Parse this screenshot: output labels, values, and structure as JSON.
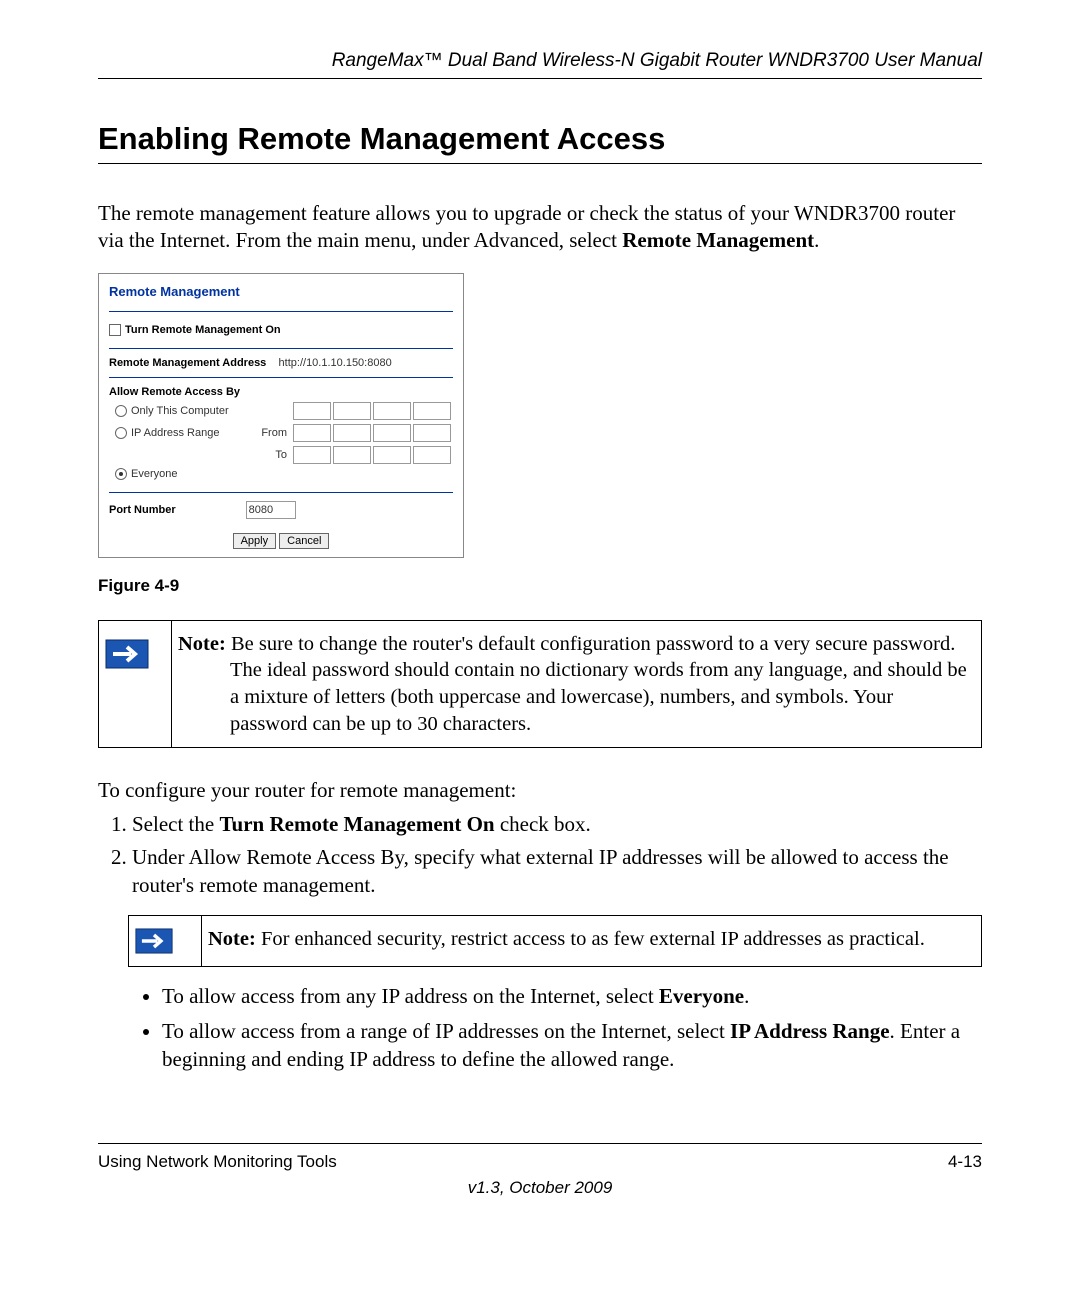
{
  "header": {
    "running_head": "RangeMax™ Dual Band Wireless-N Gigabit Router WNDR3700 User Manual"
  },
  "title": "Enabling Remote Management Access",
  "intro": {
    "text_before_bold": "The remote management feature allows you to upgrade or check the status of your WNDR3700 router via the Internet. From the main menu, under Advanced, select ",
    "bold": "Remote Management",
    "after": "."
  },
  "screenshot": {
    "title": "Remote Management",
    "turn_on_label": "Turn Remote Management On",
    "address_label": "Remote Management Address",
    "address_value": "http://10.1.10.150:8080",
    "allow_label": "Allow Remote Access By",
    "radio1": "Only This Computer",
    "radio2": "IP Address Range",
    "from_label": "From",
    "to_label": "To",
    "radio3": "Everyone",
    "port_label": "Port Number",
    "port_value": "8080",
    "btn_apply": "Apply",
    "btn_cancel": "Cancel"
  },
  "fig_caption": "Figure 4-9",
  "note1": {
    "label": "Note:",
    "text": " Be sure to change the router's default configuration password to a very secure password. The ideal password should contain no dictionary words from any language, and should be a mixture of letters (both uppercase and lowercase), numbers, and symbols. Your password can be up to 30 characters."
  },
  "cont_text": "To configure your router for remote management:",
  "steps": {
    "s1_before": "Select the ",
    "s1_bold": "Turn Remote Management On",
    "s1_after": " check box.",
    "s2": "Under Allow Remote Access By, specify what external IP addresses will be allowed to access the router's remote management."
  },
  "note2": {
    "label": "Note:",
    "text": " For enhanced security, restrict access to as few external IP addresses as practical."
  },
  "bullets": {
    "b1_before": "To allow access from any IP address on the Internet, select ",
    "b1_bold": "Everyone",
    "b1_after": ".",
    "b2_before": "To allow access from a range of IP addresses on the Internet, select ",
    "b2_bold": "IP Address Range",
    "b2_after": ". Enter a beginning and ending IP address to define the allowed range."
  },
  "footer": {
    "left": "Using Network Monitoring Tools",
    "right": "4-13",
    "center": "v1.3, October 2009"
  }
}
